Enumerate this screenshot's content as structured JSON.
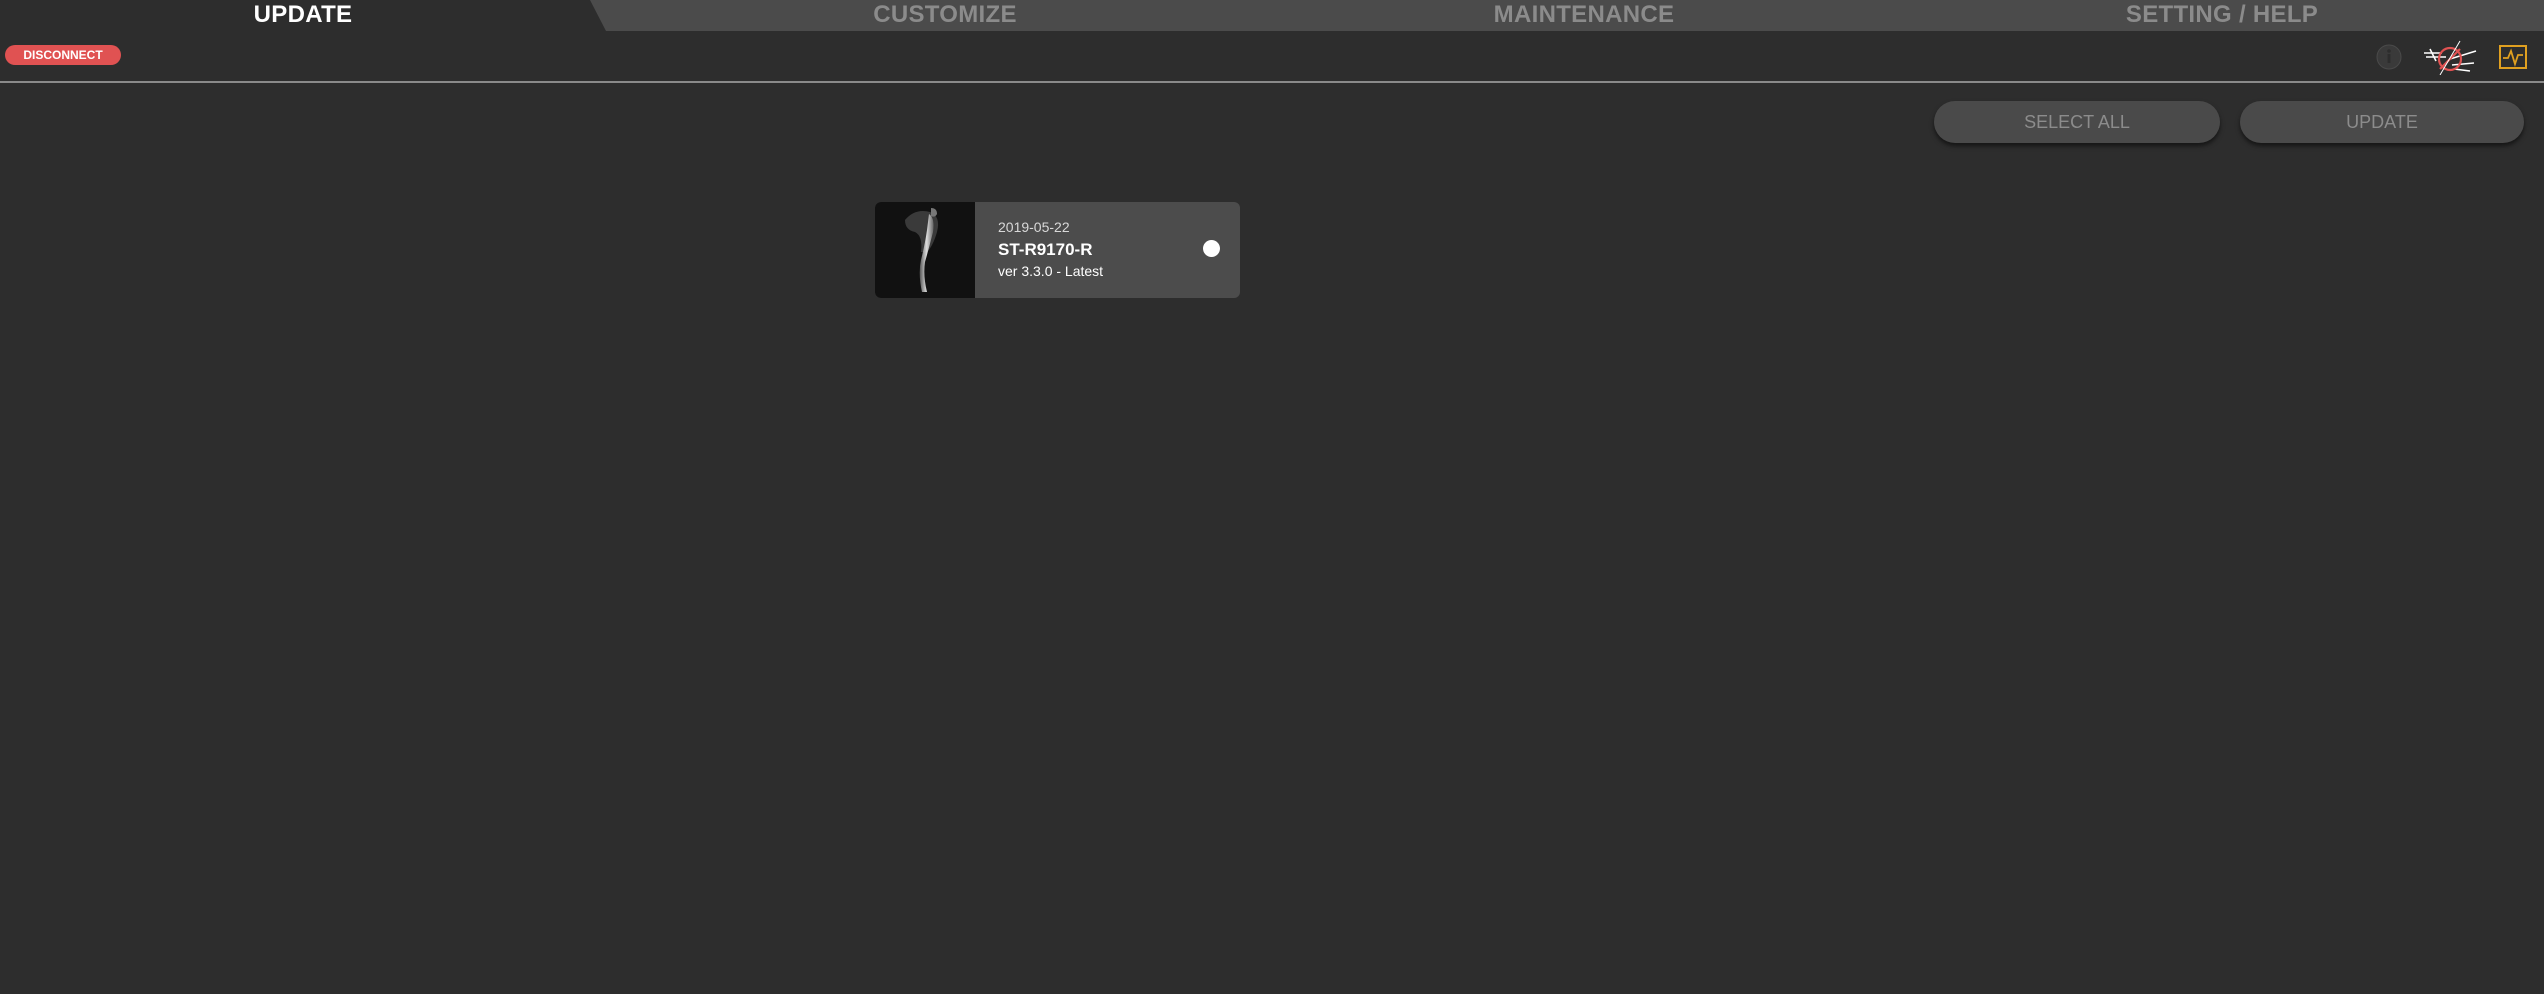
{
  "tabs": [
    {
      "label": "UPDATE",
      "active": true
    },
    {
      "label": "CUSTOMIZE",
      "active": false
    },
    {
      "label": "MAINTENANCE",
      "active": false
    },
    {
      "label": "SETTING / HELP",
      "active": false
    }
  ],
  "header": {
    "disconnect_label": "DISCONNECT",
    "icons": [
      "info-icon",
      "bike-connection-icon",
      "waveform-icon"
    ]
  },
  "actions": {
    "select_all_label": "SELECT ALL",
    "update_label": "UPDATE"
  },
  "units": [
    {
      "date": "2019-05-22",
      "name": "ST-R9170-R",
      "version": "ver 3.3.0 - Latest",
      "thumbnail": "shift-lever-icon",
      "selected": true
    }
  ],
  "colors": {
    "background": "#2d2d2d",
    "tab_strip": "#4b4b4b",
    "disconnect": "#e05252",
    "card": "#4c4c4c",
    "accent_wave": "#e0a020"
  }
}
